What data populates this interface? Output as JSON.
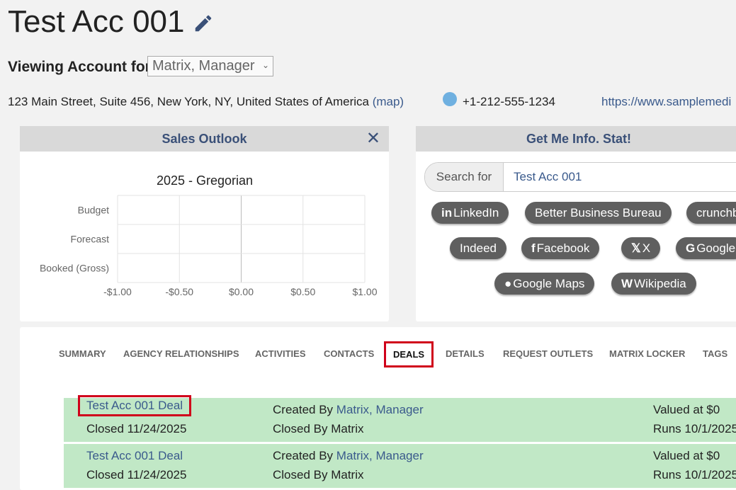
{
  "header": {
    "title": "Test Acc 001",
    "viewing_label": "Viewing Account for:",
    "viewing_value": "Matrix, Manager",
    "address": "123 Main Street, Suite 456, New York, NY, United States of America",
    "map_link": "(map)",
    "phone": "+1-212-555-1234",
    "website": "https://www.samplemedi"
  },
  "sales_outlook": {
    "title": "Sales Outlook",
    "close_icon": "close-icon"
  },
  "chart_data": {
    "type": "bar",
    "title": "2025 - Gregorian",
    "orientation": "horizontal",
    "categories": [
      "Budget",
      "Forecast",
      "Booked (Gross)"
    ],
    "values": [
      0,
      0,
      0
    ],
    "x_ticks": [
      "-$1.00",
      "-$0.50",
      "$0.00",
      "$0.50",
      "$1.00"
    ],
    "xlim": [
      -1,
      1
    ],
    "grid": true
  },
  "info_stat": {
    "title": "Get Me Info. Stat!",
    "search_label": "Search for",
    "search_value": "Test Acc 001",
    "buttons": [
      {
        "label": "LinkedIn",
        "icon": "in"
      },
      {
        "label": "Better Business Bureau",
        "icon": ""
      },
      {
        "label": "crunchb",
        "icon": ""
      },
      {
        "label": "Indeed",
        "icon": ""
      },
      {
        "label": "Facebook",
        "icon": "f"
      },
      {
        "label": "X",
        "icon": "𝕏"
      },
      {
        "label": "Google",
        "icon": "G"
      },
      {
        "label": "Google Maps",
        "icon": "●"
      },
      {
        "label": "Wikipedia",
        "icon": "W"
      }
    ]
  },
  "tabs": [
    {
      "label": "SUMMARY"
    },
    {
      "label": "AGENCY RELATIONSHIPS"
    },
    {
      "label": "ACTIVITIES"
    },
    {
      "label": "CONTACTS"
    },
    {
      "label": "DEALS"
    },
    {
      "label": "DETAILS"
    },
    {
      "label": "REQUEST OUTLETS"
    },
    {
      "label": "MATRIX LOCKER"
    },
    {
      "label": "TAGS"
    }
  ],
  "deals": [
    {
      "name": "Test Acc 001 Deal",
      "closed": "Closed 11/24/2025",
      "created_label": "Created By",
      "created_by": "Matrix, Manager",
      "closed_by": "Closed By Matrix",
      "valued": "Valued at $0",
      "runs": "Runs 10/1/2025"
    },
    {
      "name": "Test Acc 001 Deal",
      "closed": "Closed 11/24/2025",
      "created_label": "Created By",
      "created_by": "Matrix, Manager",
      "closed_by": "Closed By Matrix",
      "valued": "Valued at $0",
      "runs": "Runs 10/1/2025"
    }
  ]
}
